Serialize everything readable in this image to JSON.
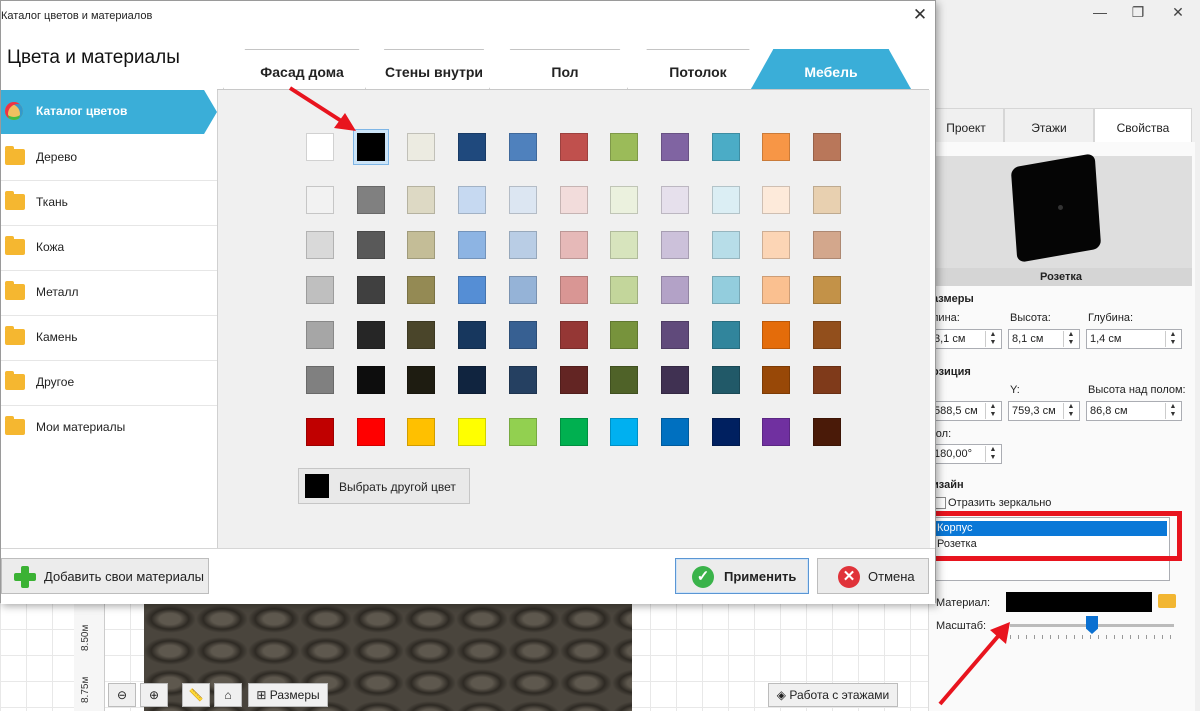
{
  "dialog": {
    "title": "Каталог цветов и материалов",
    "heading": "Цвета и материалы",
    "tabs": [
      "Фасад дома",
      "Стены внутри",
      "Пол",
      "Потолок",
      "Мебель"
    ],
    "active_tab": "Мебель",
    "sidebar": [
      {
        "label": "Каталог цветов",
        "icon": "palette-icon",
        "active": true
      },
      {
        "label": "Дерево",
        "icon": "folder-icon"
      },
      {
        "label": "Ткань",
        "icon": "folder-icon"
      },
      {
        "label": "Кожа",
        "icon": "folder-icon"
      },
      {
        "label": "Металл",
        "icon": "folder-icon"
      },
      {
        "label": "Камень",
        "icon": "folder-icon"
      },
      {
        "label": "Другое",
        "icon": "folder-icon"
      },
      {
        "label": "Мои материалы",
        "icon": "folder-icon"
      }
    ],
    "colors": [
      [
        "#ffffff",
        "#000000",
        "#ecebe1",
        "#1f497d",
        "#4f81bd",
        "#c0504d",
        "#9bbb59",
        "#8064a2",
        "#4bacc6",
        "#f79646",
        "#b9775a"
      ],
      [
        "#f2f2f2",
        "#808080",
        "#ddd9c4",
        "#c6d9f1",
        "#dce6f2",
        "#f2dcdb",
        "#ebf1de",
        "#e6e0ec",
        "#dbeef4",
        "#fdeada",
        "#e8d0b0"
      ],
      [
        "#d9d9d9",
        "#595959",
        "#c4bd97",
        "#8db4e3",
        "#b9cde5",
        "#e6b9b8",
        "#d7e4bd",
        "#ccc1da",
        "#b7dde8",
        "#fcd5b5",
        "#d3a78c"
      ],
      [
        "#bfbfbf",
        "#404040",
        "#948a54",
        "#558ed5",
        "#95b3d7",
        "#d99694",
        "#c3d69b",
        "#b3a2c7",
        "#93cddd",
        "#fac090",
        "#c39248"
      ],
      [
        "#a6a6a6",
        "#262626",
        "#4a452a",
        "#17375e",
        "#376092",
        "#953735",
        "#77933c",
        "#604a7b",
        "#31859c",
        "#e46c0a",
        "#924f1c"
      ],
      [
        "#808080",
        "#0d0d0d",
        "#1e1c11",
        "#10243f",
        "#254061",
        "#632523",
        "#4f6228",
        "#403152",
        "#215968",
        "#984807",
        "#7f3a1a"
      ],
      [
        "#c00000",
        "#ff0000",
        "#ffc000",
        "#ffff00",
        "#92d050",
        "#00b050",
        "#00b0f0",
        "#0070c0",
        "#002060",
        "#7030a0",
        "#4a1a08"
      ]
    ],
    "selected_color": "#000000",
    "pick_other_label": "Выбрать другой цвет",
    "add_materials_label": "Добавить свои материалы",
    "apply_label": "Применить",
    "cancel_label": "Отмена"
  },
  "right_panel": {
    "tabs": [
      "Проект",
      "Этажи",
      "Свойства"
    ],
    "active_tab": "Свойства",
    "preview_caption": "Розетка",
    "sizes_title": "азмеры",
    "length_label": "лина:",
    "length_value": "3,1 см",
    "height_label": "Высота:",
    "height_value": "8,1 см",
    "depth_label": "Глубина:",
    "depth_value": "1,4 см",
    "position_title": "озиция",
    "x_label": ":",
    "x_value": "588,5 см",
    "y_label": "Y:",
    "y_value": "759,3 см",
    "floor_height_label": "Высота над полом:",
    "floor_height_value": "86,8 см",
    "angle_label": "гол:",
    "angle_value": "180,00°",
    "design_title": "изайн",
    "mirror_label": "Отразить зеркально",
    "parts": [
      "Корпус",
      "Розетка"
    ],
    "selected_part": "Корпус",
    "material_label": "Материал:",
    "material_color": "#000000",
    "scale_label": "Масштаб:",
    "scale_level": 0.5
  },
  "canvas": {
    "ruler_marks": [
      "8.50м",
      "8.75м"
    ],
    "sizes_button": "Размеры",
    "floors_button": "Работа с этажами"
  }
}
